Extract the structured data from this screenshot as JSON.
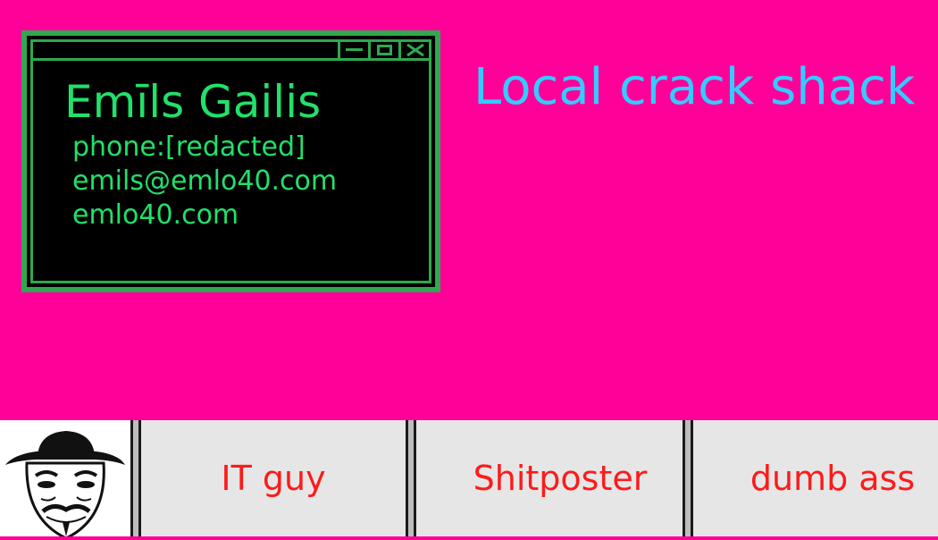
{
  "window": {
    "name": "Emīls Gailis",
    "lines": [
      "phone:[redacted]",
      "emils@emlo40.com",
      "emlo40.com"
    ],
    "controls": [
      "minimize-icon",
      "maximize-icon",
      "close-icon"
    ]
  },
  "headline": "Local crack shack",
  "taskbar": {
    "avatar_icon": "anonymous-mask-icon",
    "buttons": [
      "IT guy",
      "Shitposter",
      "dumb ass"
    ]
  },
  "colors": {
    "background": "#ff0099",
    "terminal_green": "#22e06a",
    "frame_green": "#2fa84f",
    "headline": "#33ccff",
    "taskbar": "#e6e6e6",
    "button_text": "#ff1a1a"
  }
}
